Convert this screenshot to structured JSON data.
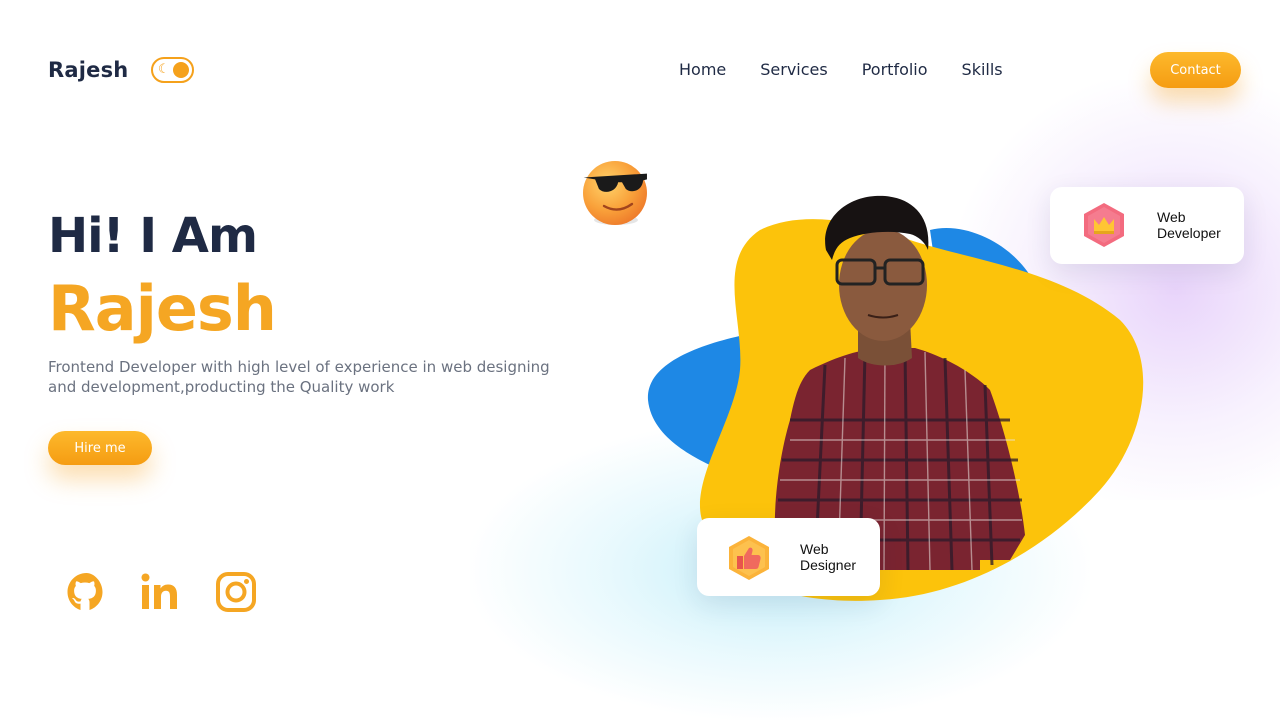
{
  "header": {
    "logo": "Rajesh",
    "theme_toggle": "moon-toggle",
    "nav": [
      "Home",
      "Services",
      "Portfolio",
      "Skills"
    ],
    "contact_label": "Contact"
  },
  "hero": {
    "greeting": "Hi! I Am",
    "name": "Rajesh",
    "description": "Frontend Developer with high level of experience in web designing and development,producting the Quality work",
    "hire_label": "Hire me"
  },
  "social": [
    {
      "icon": "github-icon"
    },
    {
      "icon": "linkedin-icon"
    },
    {
      "icon": "instagram-icon"
    }
  ],
  "cards": {
    "developer": {
      "line1": "Web",
      "line2": "Developer",
      "icon": "crown-icon"
    },
    "designer": {
      "line1": "Web",
      "line2": "Designer",
      "icon": "thumbs-up-icon"
    }
  },
  "colors": {
    "accent": "#f5a623",
    "dark": "#1f2a44",
    "blob_yellow": "#fcc30b",
    "blob_blue": "#1e88e5"
  }
}
